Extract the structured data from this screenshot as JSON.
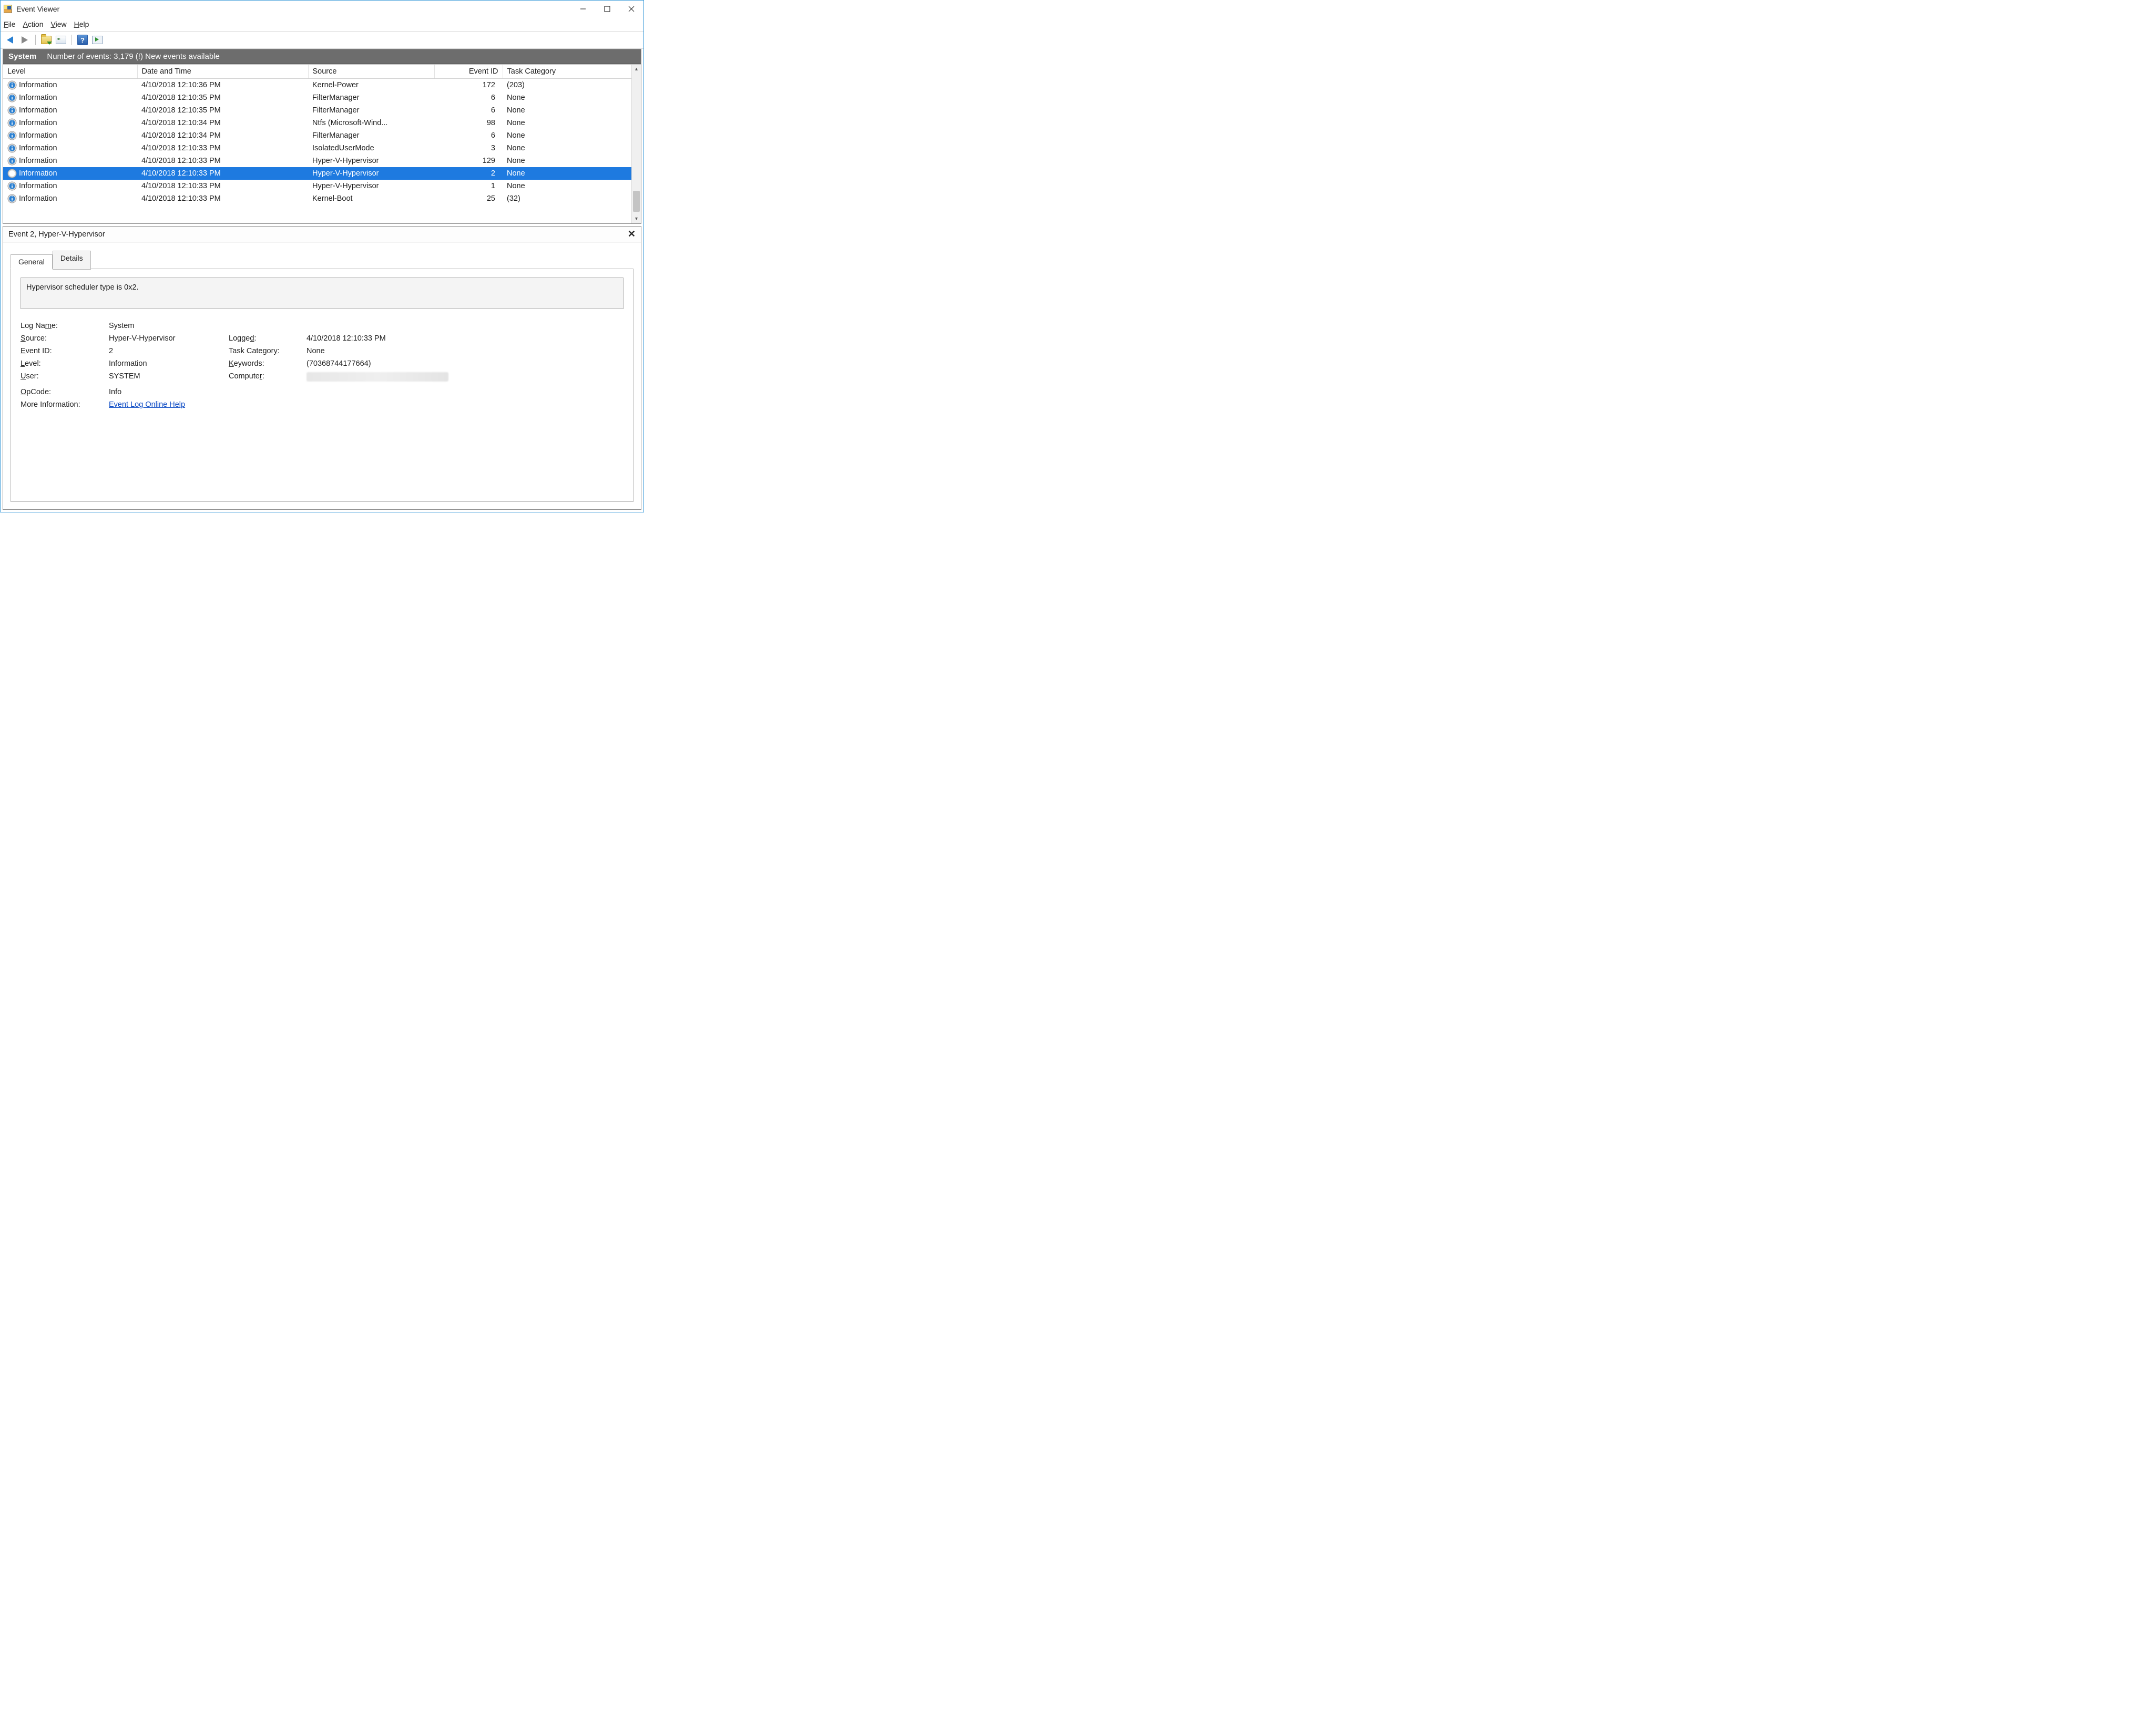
{
  "window": {
    "title": "Event Viewer"
  },
  "menu": {
    "file": "File",
    "action": "Action",
    "view": "View",
    "help": "Help"
  },
  "toolbar": {
    "back": "Back",
    "forward": "Forward",
    "open": "Open Saved Log",
    "props": "Log Properties",
    "help": "Help",
    "refresh": "Refresh"
  },
  "header": {
    "log_name": "System",
    "status": "Number of events: 3,179 (!) New events available"
  },
  "columns": {
    "level": "Level",
    "date": "Date and Time",
    "source": "Source",
    "event_id": "Event ID",
    "task": "Task Category"
  },
  "events": [
    {
      "level": "Information",
      "date": "4/10/2018 12:10:36 PM",
      "source": "Kernel-Power",
      "id": "172",
      "task": "(203)",
      "sel": false
    },
    {
      "level": "Information",
      "date": "4/10/2018 12:10:35 PM",
      "source": "FilterManager",
      "id": "6",
      "task": "None",
      "sel": false
    },
    {
      "level": "Information",
      "date": "4/10/2018 12:10:35 PM",
      "source": "FilterManager",
      "id": "6",
      "task": "None",
      "sel": false
    },
    {
      "level": "Information",
      "date": "4/10/2018 12:10:34 PM",
      "source": "Ntfs (Microsoft-Wind...",
      "id": "98",
      "task": "None",
      "sel": false
    },
    {
      "level": "Information",
      "date": "4/10/2018 12:10:34 PM",
      "source": "FilterManager",
      "id": "6",
      "task": "None",
      "sel": false
    },
    {
      "level": "Information",
      "date": "4/10/2018 12:10:33 PM",
      "source": "IsolatedUserMode",
      "id": "3",
      "task": "None",
      "sel": false
    },
    {
      "level": "Information",
      "date": "4/10/2018 12:10:33 PM",
      "source": "Hyper-V-Hypervisor",
      "id": "129",
      "task": "None",
      "sel": false
    },
    {
      "level": "Information",
      "date": "4/10/2018 12:10:33 PM",
      "source": "Hyper-V-Hypervisor",
      "id": "2",
      "task": "None",
      "sel": true
    },
    {
      "level": "Information",
      "date": "4/10/2018 12:10:33 PM",
      "source": "Hyper-V-Hypervisor",
      "id": "1",
      "task": "None",
      "sel": false
    },
    {
      "level": "Information",
      "date": "4/10/2018 12:10:33 PM",
      "source": "Kernel-Boot",
      "id": "25",
      "task": "(32)",
      "sel": false
    }
  ],
  "detail": {
    "title": "Event 2, Hyper-V-Hypervisor",
    "tab_general": "General",
    "tab_details": "Details",
    "message": "Hypervisor scheduler type is 0x2.",
    "labels": {
      "log_name": "Log Name:",
      "source": "Source:",
      "event_id": "Event ID:",
      "level": "Level:",
      "user": "User:",
      "opcode": "OpCode:",
      "more_info": "More Information:",
      "logged": "Logged:",
      "task": "Task Category:",
      "keywords": "Keywords:",
      "computer": "Computer:"
    },
    "values": {
      "log_name": "System",
      "source": "Hyper-V-Hypervisor",
      "event_id": "2",
      "level": "Information",
      "user": "SYSTEM",
      "opcode": "Info",
      "more_info": "Event Log Online Help",
      "logged": "4/10/2018 12:10:33 PM",
      "task": "None",
      "keywords": "(70368744177664)"
    }
  }
}
